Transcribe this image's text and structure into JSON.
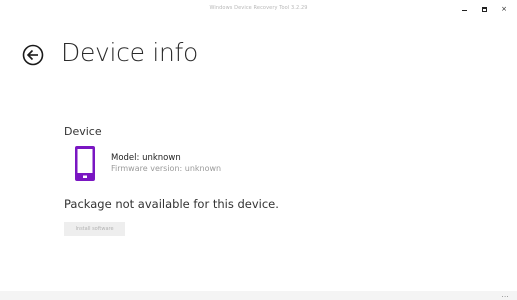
{
  "window": {
    "title": "Windows Device Recovery Tool 3.2.29",
    "controls": [
      {
        "name": "minimize-icon"
      },
      {
        "name": "maximize-icon"
      },
      {
        "name": "close-icon",
        "glyph": "×"
      }
    ]
  },
  "header": {
    "back_icon": "back-arrow-circle-icon",
    "title": "Device info"
  },
  "device": {
    "section_label": "Device",
    "icon": "phone-icon",
    "icon_color": "#7a16c2",
    "model": "Model: unknown",
    "firmware": "Firmware version: unknown"
  },
  "status": {
    "message": "Package not available for this device."
  },
  "actions": {
    "install_label": "Install software",
    "install_enabled": false
  },
  "statusbar": {
    "more_label": "..."
  }
}
